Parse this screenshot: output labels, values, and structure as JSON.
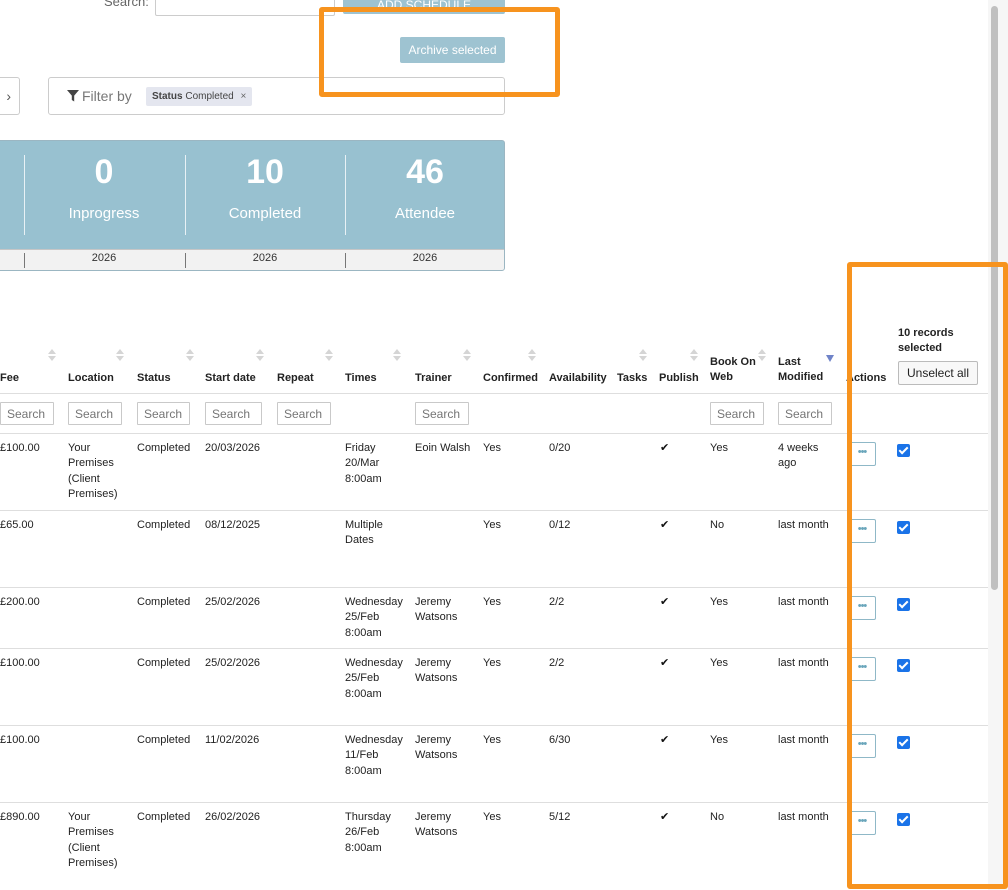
{
  "top": {
    "search_label": "Search:",
    "add_button": "ADD SCHEDULE",
    "archive_button": "Archive selected"
  },
  "filter": {
    "label": "Filter by",
    "chip_key": "Status",
    "chip_value": "Completed",
    "chip_remove": "×"
  },
  "stats": [
    {
      "value": "0",
      "label": "Inprogress",
      "year": "2026"
    },
    {
      "value": "10",
      "label": "Completed",
      "year": "2026"
    },
    {
      "value": "46",
      "label": "Attendee",
      "year": "2026"
    }
  ],
  "table": {
    "headers": {
      "fee": "Fee",
      "location": "Location",
      "status": "Status",
      "start_date": "Start date",
      "repeat": "Repeat",
      "times": "Times",
      "trainer": "Trainer",
      "confirmed": "Confirmed",
      "availability": "Availability",
      "tasks": "Tasks",
      "publish": "Publish",
      "book_on_web_1": "Book On",
      "book_on_web_2": "Web",
      "last_modified_1": "Last",
      "last_modified_2": "Modified",
      "actions": "Actions"
    },
    "search_placeholder": "Search",
    "selection_line1": "10 records",
    "selection_line2": "selected",
    "unselect_label": "Unselect all",
    "action_glyph": "•••",
    "check_glyph": "✔",
    "rows": [
      {
        "fee": "£100.00",
        "location": [
          "Your",
          "Premises",
          "(Client",
          "Premises)"
        ],
        "status": "Completed",
        "start": "20/03/2026",
        "times": [
          "Friday",
          "20/Mar",
          "8:00am"
        ],
        "trainer": [
          "Eoin Walsh"
        ],
        "confirmed": "Yes",
        "availability": "0/20",
        "book": "Yes",
        "modified": [
          "4 weeks",
          "ago"
        ]
      },
      {
        "fee": "£65.00",
        "location": [],
        "status": "Completed",
        "start": "08/12/2025",
        "times": [
          "Multiple",
          "Dates"
        ],
        "trainer": [],
        "confirmed": "Yes",
        "availability": "0/12",
        "book": "No",
        "modified": [
          "last month"
        ]
      },
      {
        "fee": "£200.00",
        "location": [],
        "status": "Completed",
        "start": "25/02/2026",
        "times": [
          "Wednesday",
          "25/Feb",
          "8:00am"
        ],
        "trainer": [
          "Jeremy",
          "Watsons"
        ],
        "confirmed": "Yes",
        "availability": "2/2",
        "book": "Yes",
        "modified": [
          "last month"
        ]
      },
      {
        "fee": "£100.00",
        "location": [],
        "status": "Completed",
        "start": "25/02/2026",
        "times": [
          "Wednesday",
          "25/Feb",
          "8:00am"
        ],
        "trainer": [
          "Jeremy",
          "Watsons"
        ],
        "confirmed": "Yes",
        "availability": "2/2",
        "book": "Yes",
        "modified": [
          "last month"
        ]
      },
      {
        "fee": "£100.00",
        "location": [],
        "status": "Completed",
        "start": "11/02/2026",
        "times": [
          "Wednesday",
          "11/Feb",
          "8:00am"
        ],
        "trainer": [
          "Jeremy",
          "Watsons"
        ],
        "confirmed": "Yes",
        "availability": "6/30",
        "book": "Yes",
        "modified": [
          "last month"
        ]
      },
      {
        "fee": "£890.00",
        "location": [
          "Your",
          "Premises",
          "(Client",
          "Premises)"
        ],
        "status": "Completed",
        "start": "26/02/2026",
        "times": [
          "Thursday",
          "26/Feb",
          "8:00am"
        ],
        "trainer": [
          "Jeremy",
          "Watsons"
        ],
        "confirmed": "Yes",
        "availability": "5/12",
        "book": "No",
        "modified": [
          "last month"
        ]
      }
    ]
  },
  "colors": {
    "highlight": "#f7931e",
    "accent": "#98c1d0",
    "checkbox": "#1a73e8"
  }
}
